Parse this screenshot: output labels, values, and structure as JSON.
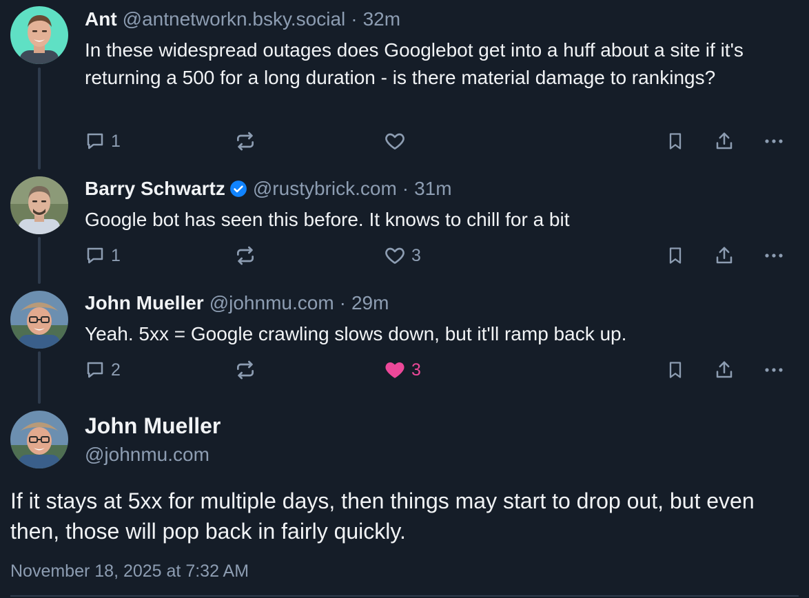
{
  "colors": {
    "background": "#151d28",
    "text": "#f1f3f5",
    "muted": "#8d9db2",
    "like": "#ec4899",
    "verified": "#1083fe"
  },
  "posts": [
    {
      "author": "Ant",
      "handle": "@antnetworkn.bsky.social",
      "separator": "·",
      "time": "32m",
      "text": "In these widespread outages does Googlebot get into a huff about a site if it's returning a 500 for a long duration - is there material damage to rankings?",
      "verified": false,
      "reply_count": "1",
      "repost_count": "",
      "like_count": "",
      "liked": false,
      "icons": [
        "reply-icon",
        "repost-icon",
        "heart-icon",
        "bookmark-icon",
        "share-icon",
        "more-icon"
      ]
    },
    {
      "author": "Barry Schwartz",
      "handle": "@rustybrick.com",
      "separator": "·",
      "time": "31m",
      "text": "Google bot has seen this before. It knows to chill for a bit",
      "verified": true,
      "reply_count": "1",
      "repost_count": "",
      "like_count": "3",
      "liked": false,
      "icons": [
        "reply-icon",
        "repost-icon",
        "heart-icon",
        "bookmark-icon",
        "share-icon",
        "more-icon"
      ]
    },
    {
      "author": "John Mueller",
      "handle": "@johnmu.com",
      "separator": "·",
      "time": "29m",
      "text": "Yeah. 5xx = Google crawling slows down, but it'll ramp back up.",
      "verified": false,
      "reply_count": "2",
      "repost_count": "",
      "like_count": "3",
      "liked": true,
      "icons": [
        "reply-icon",
        "repost-icon",
        "heart-filled-icon",
        "bookmark-icon",
        "share-icon",
        "more-icon"
      ]
    }
  ],
  "main_post": {
    "author": "John Mueller",
    "handle": "@johnmu.com",
    "text": "If it stays at 5xx for multiple days, then things may start to drop out, but even then, those will pop back in fairly quickly.",
    "date": "November 18, 2025 at 7:32 AM"
  }
}
